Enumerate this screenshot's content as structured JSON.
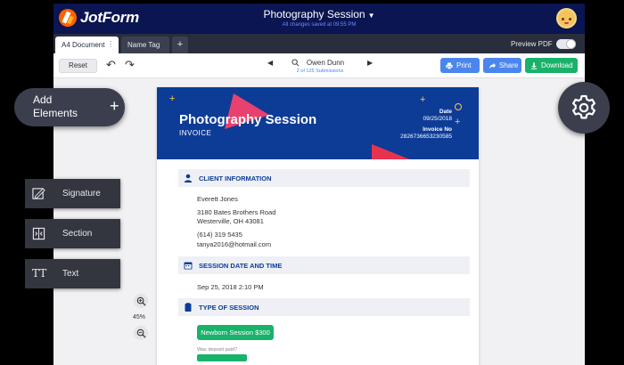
{
  "app": {
    "logo_text": "JotForm",
    "form_title": "Photography Session",
    "save_status": "All changes saved at 09:55 PM"
  },
  "tabs": [
    {
      "label": "A4 Document"
    },
    {
      "label": "Name Tag"
    }
  ],
  "tab_add_label": "+",
  "preview_pdf_label": "Preview PDF",
  "toolbar": {
    "reset_label": "Reset",
    "submitter_name": "Owen Dunn",
    "submission_count": "2 of 125 Submissions",
    "print_label": "Print",
    "share_label": "Share",
    "download_label": "Download"
  },
  "document": {
    "title": "Photography Session",
    "subtitle": "INVOICE",
    "date_label": "Date",
    "date_value": "09/25/2018",
    "invoice_label": "Invoice No",
    "invoice_value": "2826736653230585",
    "sections": {
      "client": {
        "heading": "CLIENT INFORMATION",
        "name": "Everett Jones",
        "address_line1": "3180 Bates Brothers Road",
        "address_line2": "Westerville, OH 43081",
        "phone": "(614) 319 5435",
        "email": "tanya2016@hotmail.com"
      },
      "session_date": {
        "heading": "SESSION DATE AND TIME",
        "value": "Sep 25, 2018 2:10 PM"
      },
      "session_type": {
        "heading": "TYPE OF SESSION",
        "value": "Newborn Session $300",
        "next_question": "Was deposit paid?"
      }
    }
  },
  "zoom": {
    "level": "45%"
  },
  "sidebar": {
    "add_elements_label": "Add Elements",
    "add_icon": "+",
    "elements": [
      {
        "label": "Signature",
        "icon": "signature-icon"
      },
      {
        "label": "Section",
        "icon": "section-icon"
      },
      {
        "label": "Text",
        "icon": "text-icon",
        "glyph": "TT"
      }
    ]
  },
  "colors": {
    "navy": "#0a1551",
    "brand_orange": "#ff6100",
    "doc_blue": "#0d3c97",
    "accent_pink": "#e8416f",
    "green": "#19b26b",
    "button_blue": "#4a86ee"
  }
}
